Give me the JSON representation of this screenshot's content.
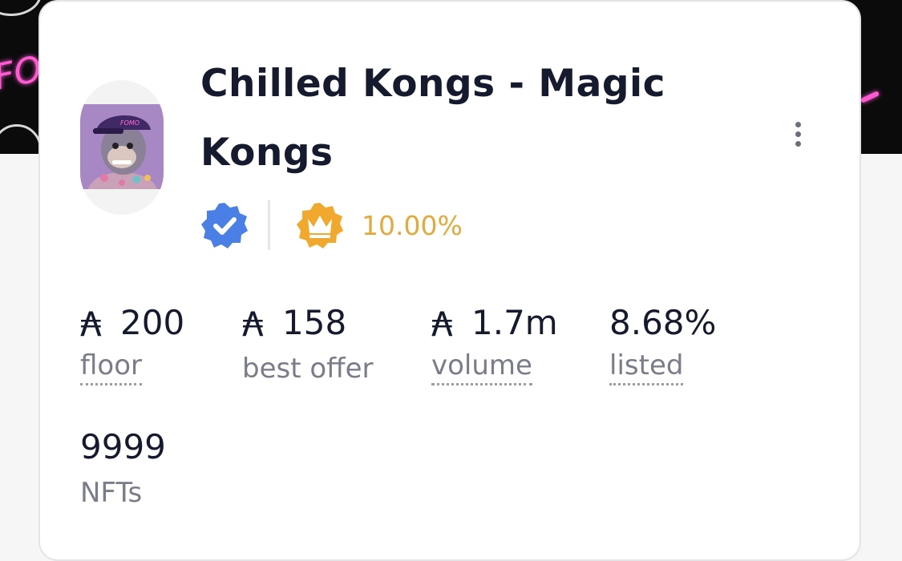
{
  "collection": {
    "title": "Chilled Kongs - Magic Kongs",
    "title_line1": "Chilled Kongs - Magic",
    "title_line2": "Kongs",
    "royalty": "10.00%",
    "currency_symbol": "₳"
  },
  "icons": {
    "verified": "verified-badge-icon",
    "royalty": "crown-badge-icon",
    "menu": "vertical-ellipsis-icon"
  },
  "colors": {
    "verified_blue": "#4a7fe6",
    "royalty_gold": "#f0a92c",
    "text_dark": "#161a2e",
    "text_muted": "#7a7d89"
  },
  "stats": {
    "floor": {
      "value": "200",
      "label": "floor"
    },
    "best_offer": {
      "value": "158",
      "label": "best offer"
    },
    "volume": {
      "value": "1.7m",
      "label": "volume"
    },
    "listed": {
      "value": "8.68%",
      "label": "listed"
    },
    "nfts": {
      "value": "9999",
      "label": "NFTs"
    }
  }
}
